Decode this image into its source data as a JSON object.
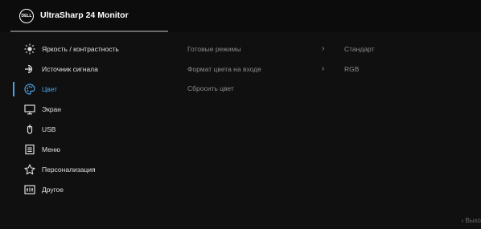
{
  "header": {
    "logo_text": "DELL",
    "title": "UltraSharp 24 Monitor"
  },
  "menu": {
    "items": [
      {
        "label": "Яркость / контрастность",
        "icon": "brightness-icon"
      },
      {
        "label": "Источник сигнала",
        "icon": "input-source-icon"
      },
      {
        "label": "Цвет",
        "icon": "color-palette-icon",
        "active": true
      },
      {
        "label": "Экран",
        "icon": "display-icon"
      },
      {
        "label": "USB",
        "icon": "usb-icon"
      },
      {
        "label": "Меню",
        "icon": "menu-icon"
      },
      {
        "label": "Персонализация",
        "icon": "star-icon"
      },
      {
        "label": "Другое",
        "icon": "others-icon"
      }
    ]
  },
  "content": {
    "rows": [
      {
        "name": "Готовые режимы",
        "chevron": "›",
        "value": "Стандарт"
      },
      {
        "name": "Формат цвета на входе",
        "chevron": "›",
        "value": "RGB"
      },
      {
        "name": "Сбросить цвет"
      }
    ]
  },
  "footer": {
    "exit_label": "‹ Выхо"
  },
  "colors": {
    "accent": "#4aa3e8",
    "background": "#101010",
    "muted_text": "#8a8a8a"
  }
}
